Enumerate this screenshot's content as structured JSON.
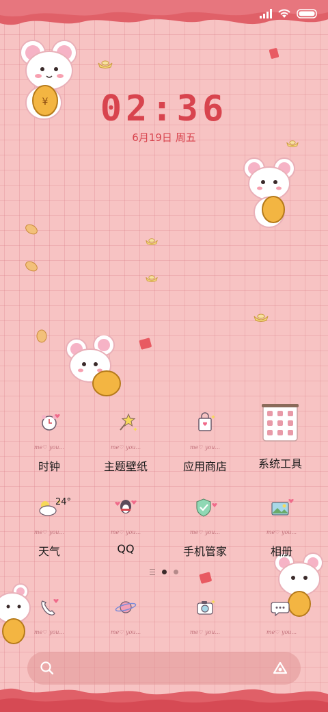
{
  "lock": {
    "time": "02:36",
    "date": "6月19日 周五"
  },
  "apps_row1": [
    {
      "label": "时钟",
      "icon": "alarm-clock-icon"
    },
    {
      "label": "主题壁纸",
      "icon": "star-wand-icon"
    },
    {
      "label": "应用商店",
      "icon": "shopping-bag-icon"
    },
    {
      "label": "系统工具",
      "icon": "tools-folder-icon"
    }
  ],
  "apps_row2": [
    {
      "label": "天气",
      "icon": "weather-cloud-icon",
      "badge": "24°"
    },
    {
      "label": "QQ",
      "icon": "qq-penguin-icon"
    },
    {
      "label": "手机管家",
      "icon": "shield-check-icon"
    },
    {
      "label": "相册",
      "icon": "photo-icon"
    }
  ],
  "dock": [
    {
      "icon": "phone-icon"
    },
    {
      "icon": "planet-icon"
    },
    {
      "icon": "camera-icon"
    },
    {
      "icon": "message-bubble-icon"
    }
  ],
  "meyou_text": "me♡ you...",
  "page_indicator": {
    "pages": 2,
    "active": 1
  },
  "colors": {
    "accent": "#d8444e",
    "background": "#f7c3c3",
    "wave": "#e06068"
  }
}
